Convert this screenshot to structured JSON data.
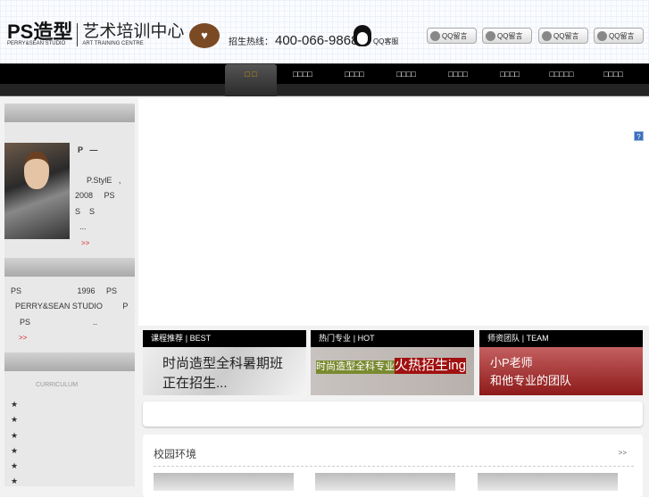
{
  "header": {
    "logo_main": "PS造型",
    "logo_sub": "PERRY&SEAN STUDIO",
    "logo_cn": "艺术培训中心",
    "logo_en": "ART TRAINING CENTRE",
    "hotline_label": "招生热线：",
    "hotline": "400-066-9868",
    "qq_service": "QQ客服",
    "qq_message": "QQ留言"
  },
  "nav": {
    "items": [
      "□ □",
      "□□□□",
      "□□□□",
      "□□□□",
      "□□□□",
      "□□□□",
      "□□□□□",
      "□□□□"
    ]
  },
  "sidebar": {
    "teacher": {
      "l1": "P   —",
      "l2": "    P.StylE   ,",
      "l3": "2008     PS",
      "l4": "S    S",
      "l5": "  ...",
      "more": ">>"
    },
    "about": {
      "l1": "PS                         1996     PS",
      "l2": "  PERRY&SEAN STUDIO         P",
      "l3": "    PS                            ..",
      "more": ">>"
    },
    "curriculum": {
      "label": "CURRICULUM",
      "stars": [
        "★",
        "★",
        "★",
        "★",
        "★",
        "★"
      ]
    }
  },
  "main": {
    "help": "?"
  },
  "cards": [
    {
      "title": "课程推荐",
      "tag": "| BEST",
      "l1": "时尚造型全科暑期班",
      "l2": "正在招生..."
    },
    {
      "title": "热门专业",
      "tag": "| HOT",
      "l1": "时尚造型全科专业",
      "l2": "火热招生ing"
    },
    {
      "title": "师资团队",
      "tag": "| TEAM",
      "l1": "小P老师",
      "l2": "和他专业的团队"
    }
  ],
  "campus": {
    "title": "校园环境",
    "more": ">>"
  }
}
